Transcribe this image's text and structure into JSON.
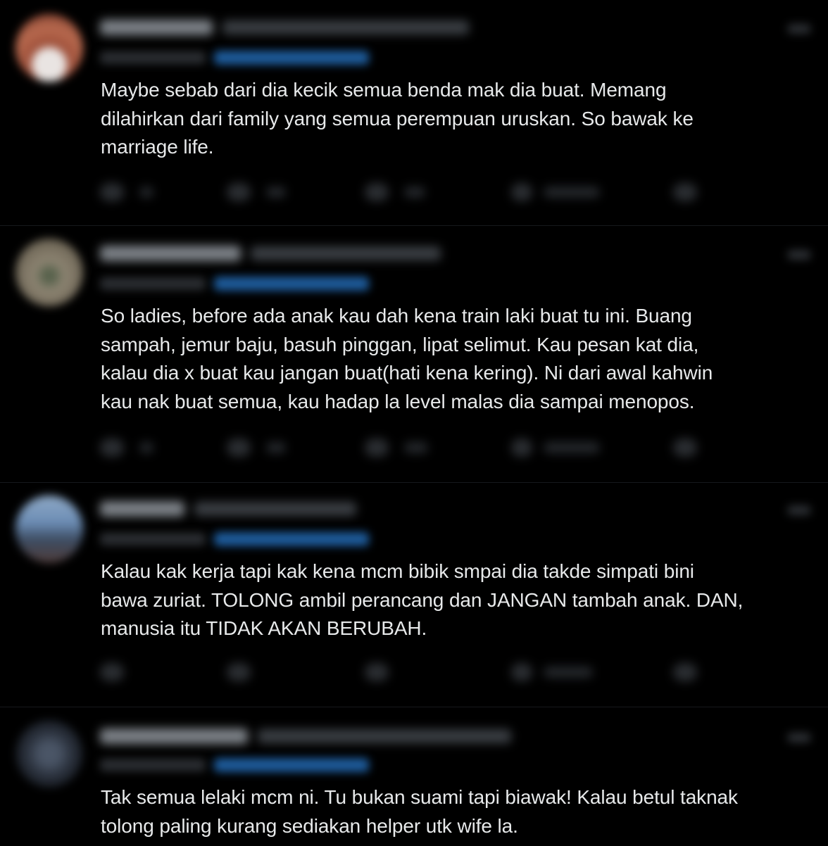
{
  "tweets": [
    {
      "text": "Maybe sebab dari dia kecik semua benda mak dia buat. Memang\ndilahirkan dari family yang semua perempuan uruskan. So bawak ke\nmarriage life."
    },
    {
      "text": "So ladies, before ada anak kau dah kena train laki buat tu ini. Buang\nsampah, jemur baju, basuh pinggan, lipat selimut. Kau pesan kat dia,\nkalau dia x buat kau jangan buat(hati kena kering). Ni dari awal kahwin\nkau nak buat semua, kau hadap la level malas dia sampai menopos."
    },
    {
      "text": "Kalau kak kerja tapi kak kena mcm bibik smpai dia takde simpati bini\nbawa zuriat. TOLONG ambil perancang dan JANGAN tambah anak. DAN,\nmanusia itu TIDAK AKAN BERUBAH."
    },
    {
      "text": "Tak semua lelaki mcm ni. Tu bukan suami tapi biawak! Kalau betul taknak\ntolong paling kurang sediakan helper utk wife la."
    }
  ],
  "icons": {
    "reply": "reply-icon",
    "retweet": "retweet-icon",
    "like": "heart-icon",
    "views": "views-icon",
    "bookmark": "bookmark-icon",
    "more": "more-icon"
  },
  "colors": {
    "background": "#000000",
    "text": "#e7e9ea",
    "mention": "#1d9bf0",
    "divider": "#2f3336"
  }
}
